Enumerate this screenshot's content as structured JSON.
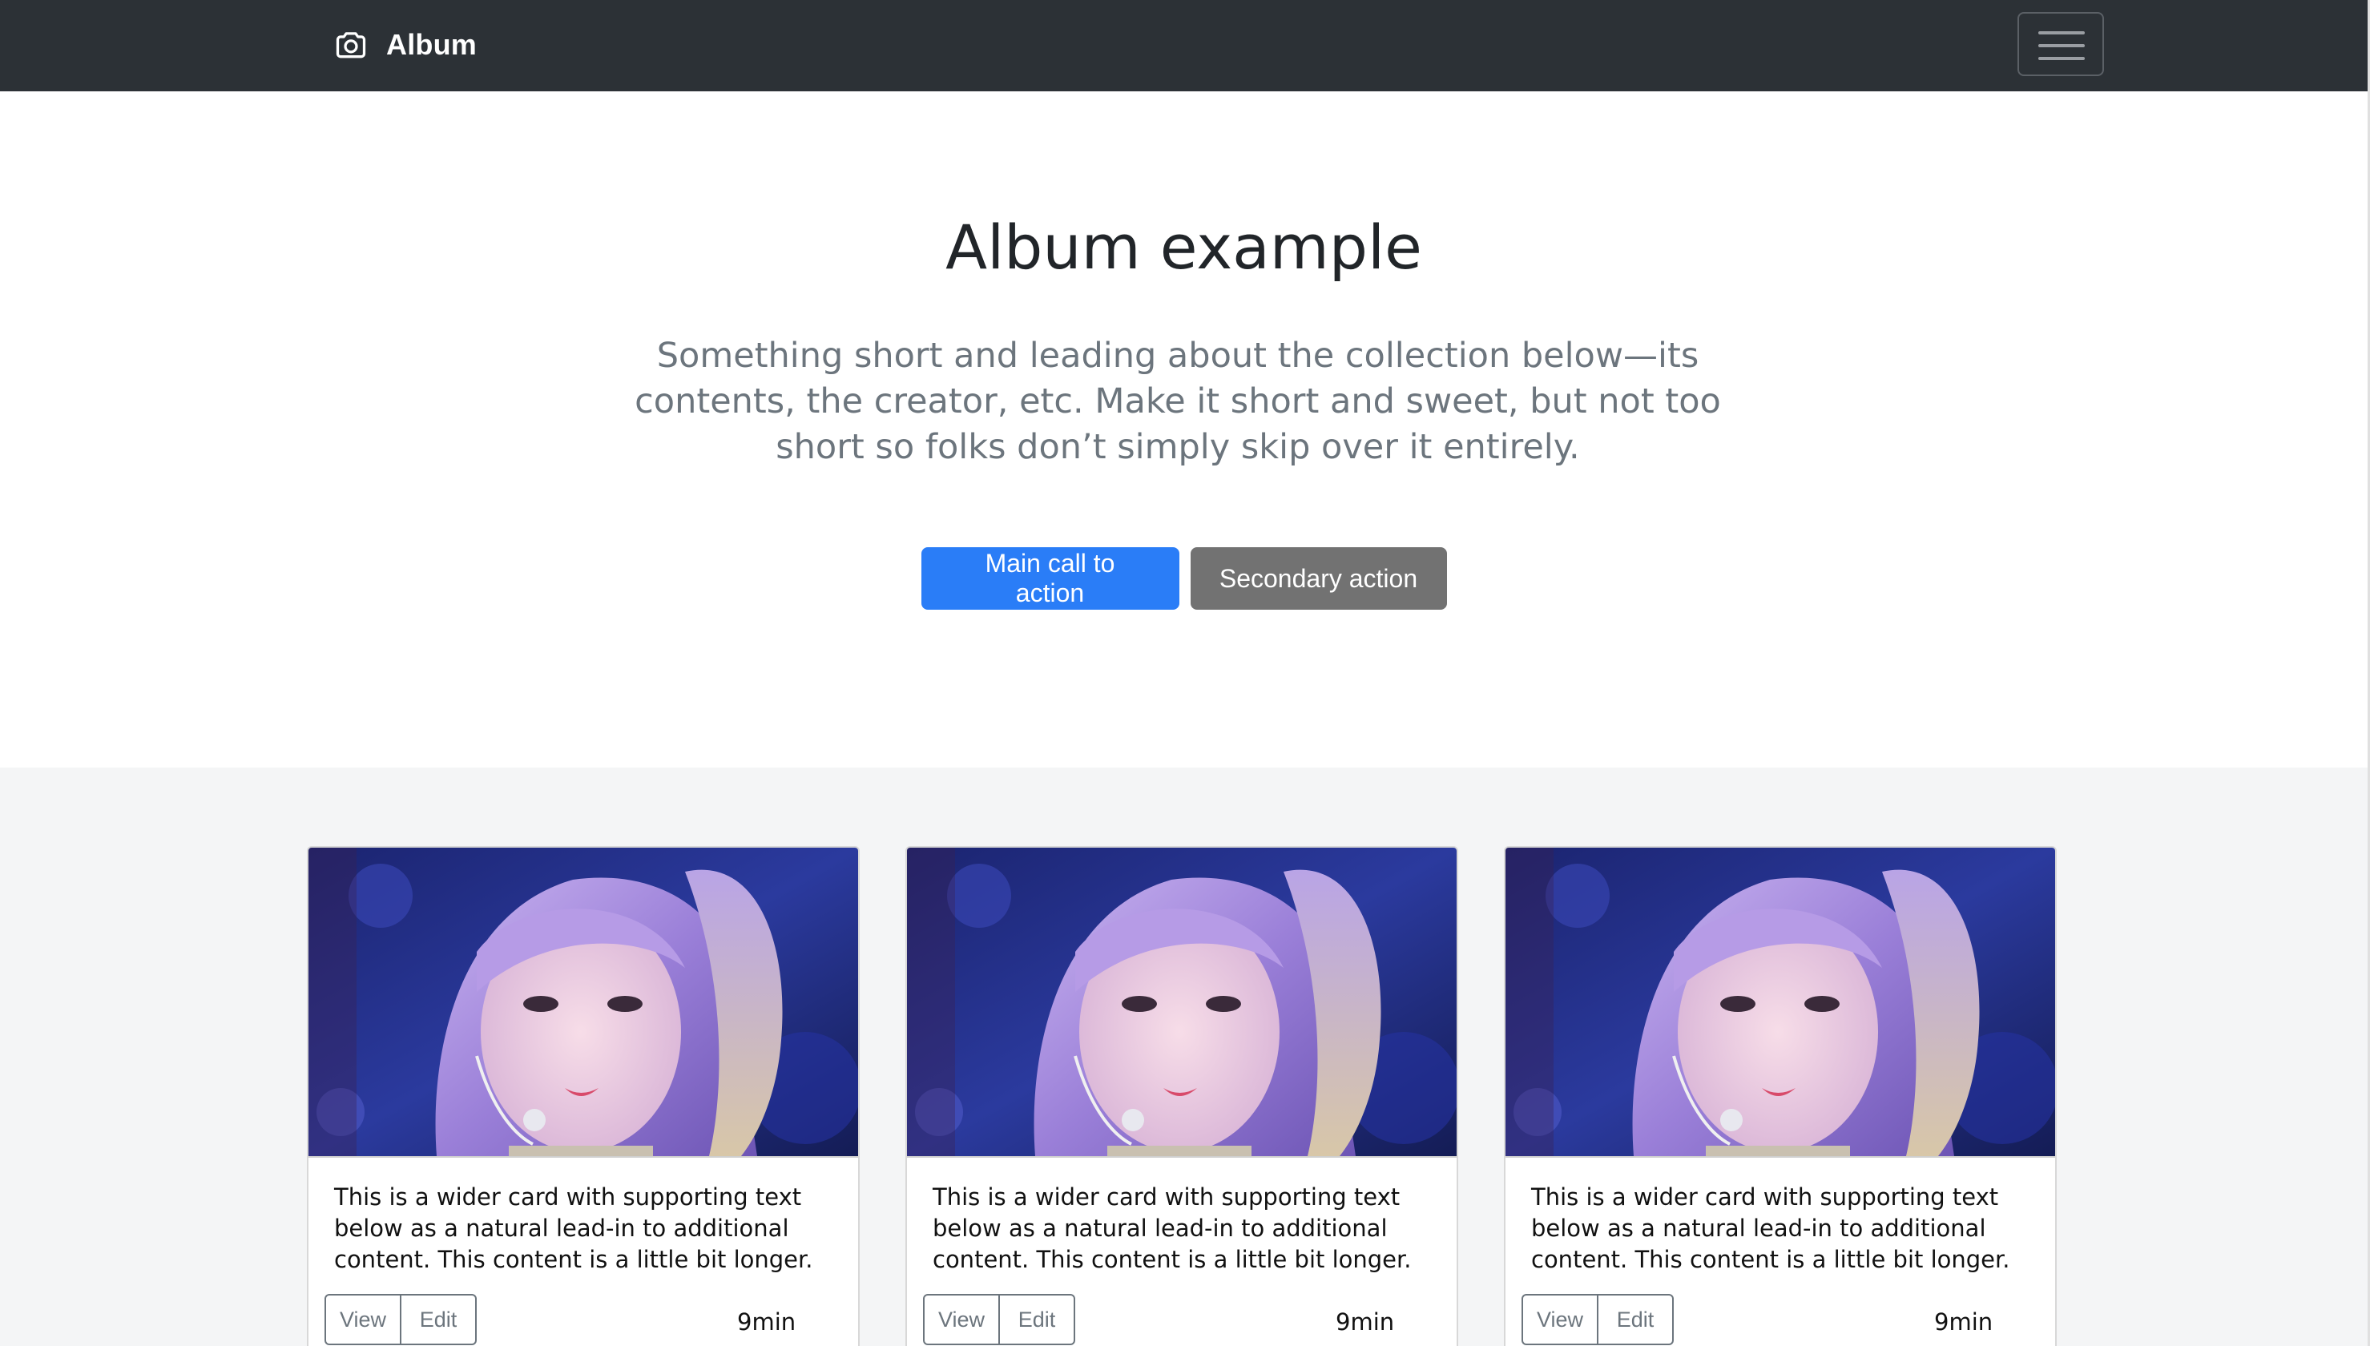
{
  "navbar": {
    "brand": "Album",
    "brand_icon": "camera-icon",
    "toggle_icon": "hamburger-icon",
    "background": "#2c3136"
  },
  "hero": {
    "title": "Album example",
    "lead": "Something short and leading about the collection below—its contents, the creator, etc. Make it short and sweet, but not too short so folks don’t simply skip over it entirely.",
    "primary_button": "Main call to action",
    "secondary_button": "Secondary action",
    "primary_color": "#2a7df7",
    "secondary_color": "#727272"
  },
  "album": {
    "background": "#f4f5f6",
    "cards": [
      {
        "image": "photo of a performer with lavender hair and a headset microphone",
        "text": "This is a wider card with supporting text below as a natural lead-in to additional content. This content is a little bit longer.",
        "view_label": "View",
        "edit_label": "Edit",
        "duration": "9min"
      },
      {
        "image": "photo of a performer with lavender hair and a headset microphone",
        "text": "This is a wider card with supporting text below as a natural lead-in to additional content. This content is a little bit longer.",
        "view_label": "View",
        "edit_label": "Edit",
        "duration": "9min"
      },
      {
        "image": "photo of a performer with lavender hair and a headset microphone",
        "text": "This is a wider card with supporting text below as a natural lead-in to additional content. This content is a little bit longer.",
        "view_label": "View",
        "edit_label": "Edit",
        "duration": "9min"
      }
    ]
  }
}
